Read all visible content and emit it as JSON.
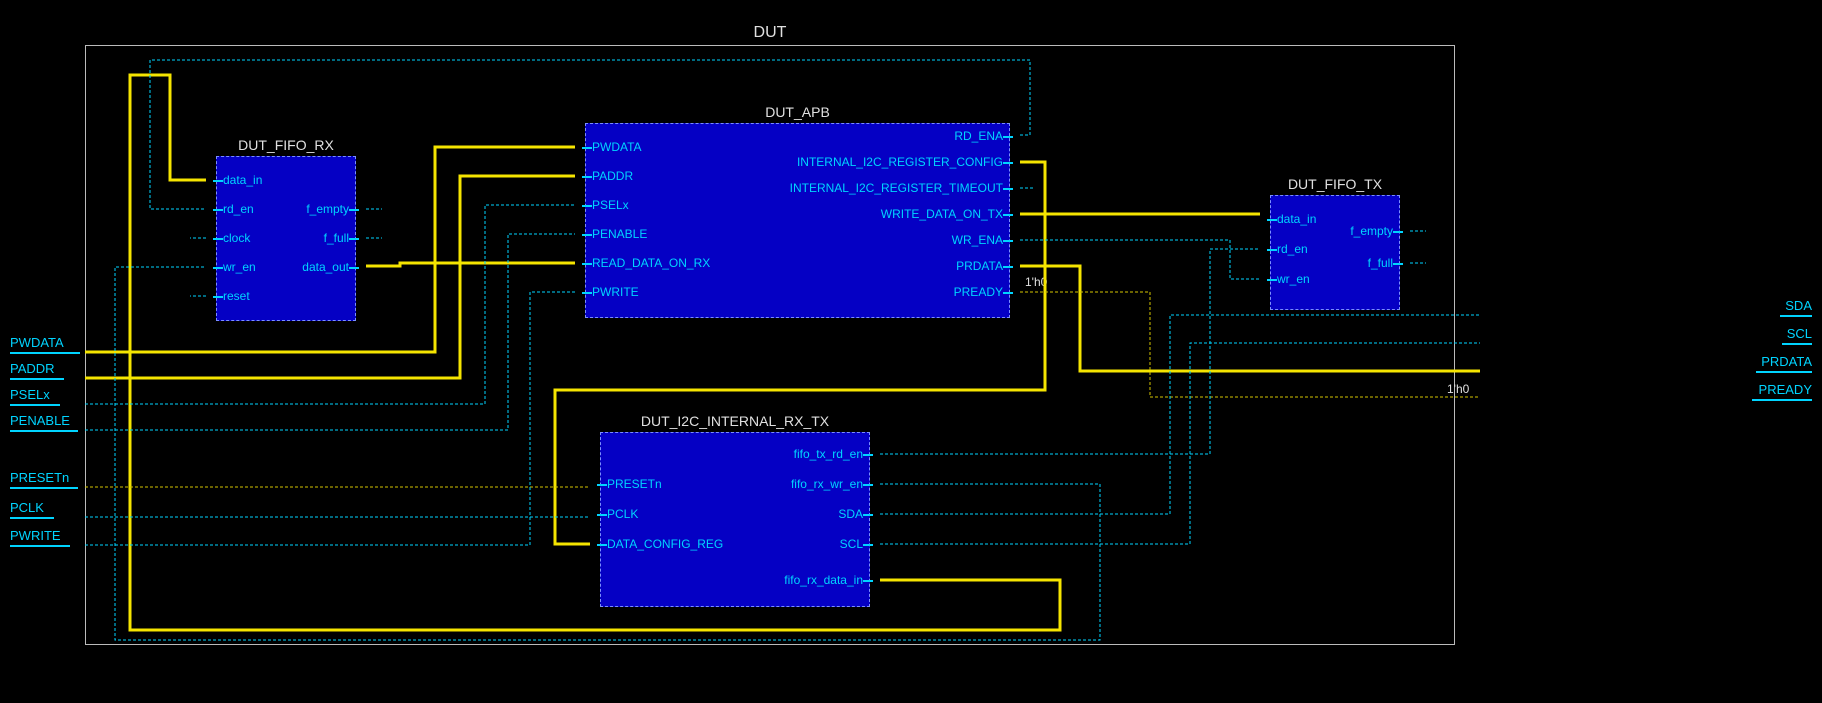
{
  "diagram": {
    "top_title": "DUT",
    "blocks": {
      "fifo_rx": {
        "title": "DUT_FIFO_RX",
        "ports_left": [
          "data_in",
          "rd_en",
          "clock",
          "wr_en",
          "reset"
        ],
        "ports_right": [
          "f_empty",
          "f_full",
          "data_out"
        ]
      },
      "apb": {
        "title": "DUT_APB",
        "ports_left": [
          "PWDATA",
          "PADDR",
          "PSELx",
          "PENABLE",
          "READ_DATA_ON_RX",
          "PWRITE"
        ],
        "ports_right": [
          "RD_ENA",
          "INTERNAL_I2C_REGISTER_CONFIG",
          "INTERNAL_I2C_REGISTER_TIMEOUT",
          "WRITE_DATA_ON_TX",
          "WR_ENA",
          "PRDATA",
          "PREADY"
        ]
      },
      "i2c": {
        "title": "DUT_I2C_INTERNAL_RX_TX",
        "ports_left": [
          "PRESETn",
          "PCLK",
          "DATA_CONFIG_REG"
        ],
        "ports_right": [
          "fifo_tx_rd_en",
          "fifo_rx_wr_en",
          "SDA",
          "SCL",
          "fifo_rx_data_in"
        ]
      },
      "fifo_tx": {
        "title": "DUT_FIFO_TX",
        "ports_left": [
          "data_in",
          "rd_en",
          "wr_en"
        ],
        "ports_right": [
          "f_empty",
          "f_full"
        ]
      }
    },
    "ext_left": [
      "PWDATA",
      "PADDR",
      "PSELx",
      "PENABLE",
      "PRESETn",
      "PCLK",
      "PWRITE"
    ],
    "ext_right": [
      "SDA",
      "SCL",
      "PRDATA",
      "PREADY"
    ],
    "constants": {
      "c1": "1'h0",
      "c2": "1'h0"
    }
  }
}
